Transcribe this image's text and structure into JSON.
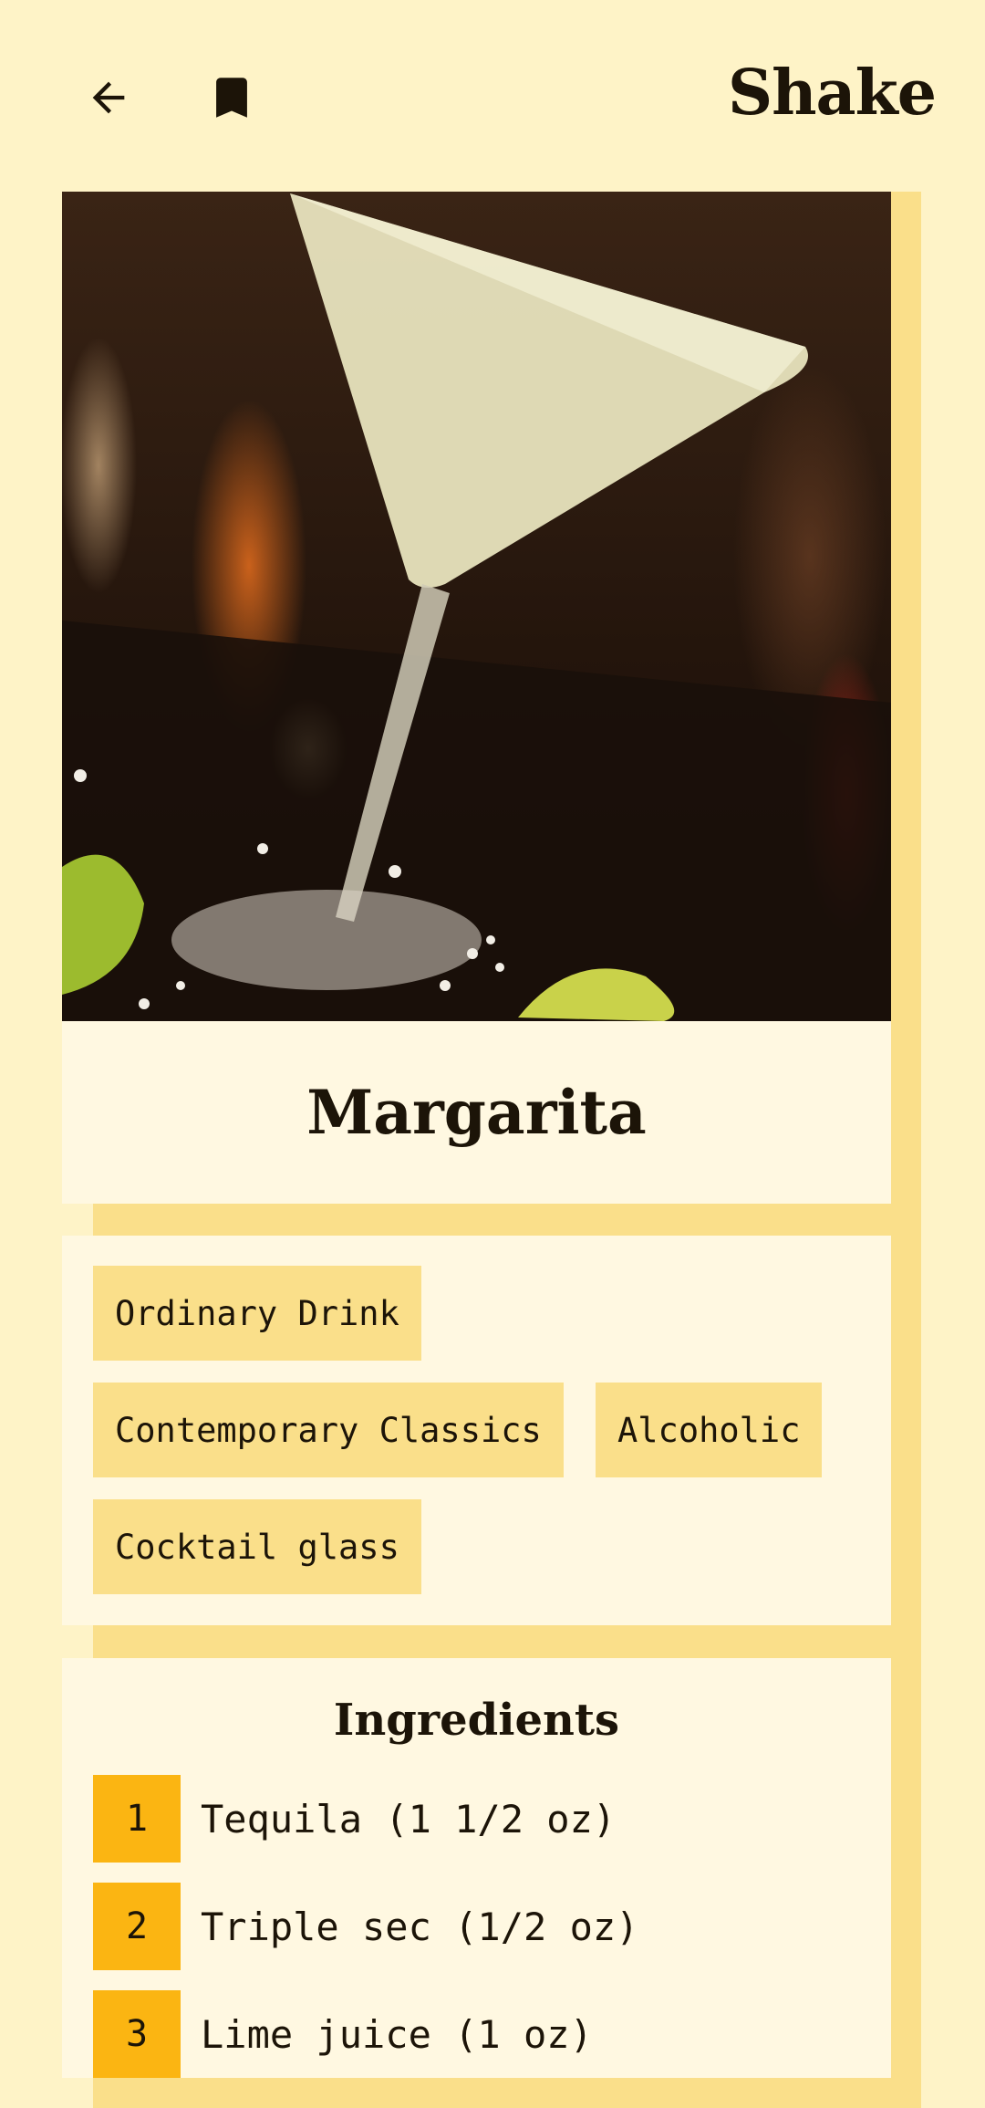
{
  "app": {
    "title": "Shake"
  },
  "toolbar": {
    "back_icon": "arrow-left-icon",
    "bookmark_icon": "bookmark-icon"
  },
  "drink": {
    "name": "Margarita",
    "image_description_icon": "cocktail-photo",
    "tags": [
      "Ordinary Drink",
      "Contemporary Classics",
      "Alcoholic",
      "Cocktail glass"
    ]
  },
  "ingredients": {
    "heading": "Ingredients",
    "items": [
      {
        "index": "1",
        "text": "Tequila (1 1/2 oz)"
      },
      {
        "index": "2",
        "text": "Triple sec (1/2 oz)"
      },
      {
        "index": "3",
        "text": "Lime juice (1 oz)"
      }
    ]
  },
  "colors": {
    "background": "#FEF3C7",
    "panel": "#FFF8E1",
    "tag": "#FADF8A",
    "accent": "#FBB512",
    "text": "#1C1408"
  }
}
